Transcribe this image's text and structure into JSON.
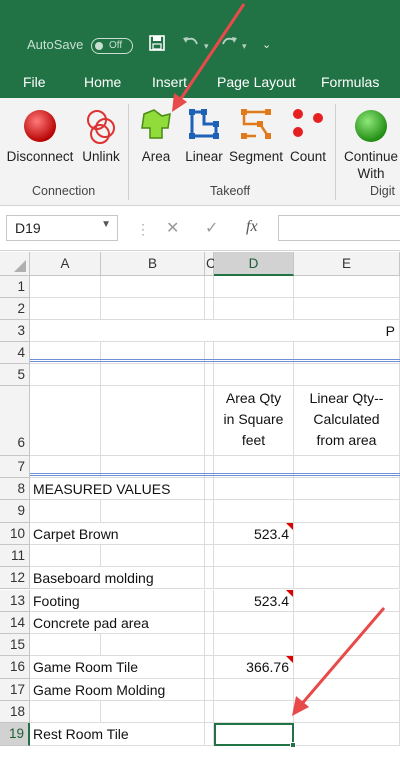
{
  "titlebar": {
    "autosave_label": "AutoSave",
    "autosave_state": "Off"
  },
  "tabs": [
    "File",
    "Home",
    "Insert",
    "Page Layout",
    "Formulas"
  ],
  "ribbon": {
    "connection": {
      "label": "Connection",
      "buttons": [
        "Disconnect",
        "Unlink"
      ]
    },
    "takeoff": {
      "label": "Takeoff",
      "buttons": [
        "Area",
        "Linear",
        "Segment",
        "Count"
      ]
    },
    "digitizer": {
      "label": "Digit",
      "button_line1": "Continue",
      "button_line2": "With"
    }
  },
  "formula_bar": {
    "name_box": "D19",
    "fx": "fx",
    "value": ""
  },
  "columns": [
    "A",
    "B",
    "C",
    "D",
    "E"
  ],
  "rows": [
    "1",
    "2",
    "3",
    "4",
    "5",
    "6",
    "7",
    "8",
    "9",
    "10",
    "11",
    "12",
    "13",
    "14",
    "15",
    "16",
    "17",
    "18",
    "19"
  ],
  "cells": {
    "e3": "P",
    "d6": [
      "Area Qty",
      "in Square",
      "feet"
    ],
    "e6": [
      "Linear Qty--",
      "Calculated",
      "from area"
    ],
    "a8": "MEASURED VALUES",
    "a10": "Carpet Brown",
    "d10": "523.4",
    "a12": "Baseboard molding",
    "a13": "Footing",
    "d13": "523.4",
    "a14": "Concrete pad area",
    "a16": "Game Room Tile",
    "d16": "366.76",
    "a17": "Game Room Molding",
    "a19": "Rest Room Tile"
  },
  "colors": {
    "excel_green": "#217346",
    "annotation_arrow": "#e84a4a"
  }
}
